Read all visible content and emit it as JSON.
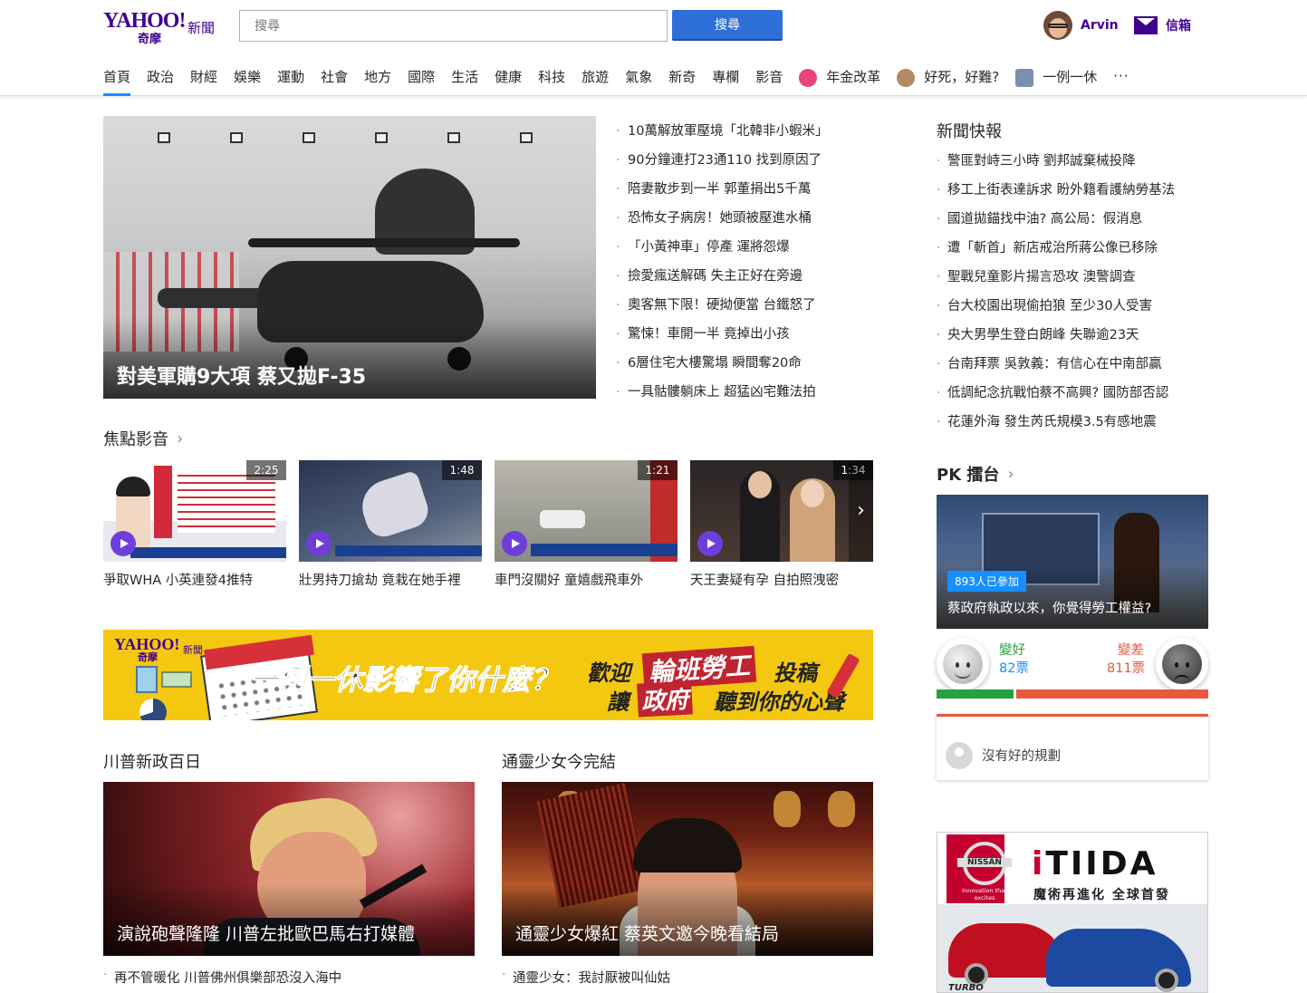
{
  "header": {
    "logo_yahoo": "YAHOO!",
    "logo_sub": "奇摩",
    "logo_section": "新聞",
    "search_placeholder": "搜尋",
    "search_button": "搜尋",
    "user_name": "Arvin",
    "mail_label": "信箱"
  },
  "nav": {
    "items": [
      "首頁",
      "政治",
      "財經",
      "娛樂",
      "運動",
      "社會",
      "地方",
      "國際",
      "生活",
      "健康",
      "科技",
      "旅遊",
      "氣象",
      "新奇",
      "專欄",
      "影音"
    ],
    "special": [
      "年金改革",
      "好死，好難?",
      "一例一休"
    ],
    "more": "···",
    "active": "首頁"
  },
  "hero": {
    "title": "對美軍購9大項 蔡又拋F-35"
  },
  "headlines": [
    "10萬解放軍壓境「北韓非小蝦米」",
    "90分鐘連打23通110 找到原因了",
    "陪妻散步到一半 郭董捐出5千萬",
    "恐怖女子病房！她頭被壓進水桶",
    "「小黃神車」停產 運將怨爆",
    "撿愛瘋送解碼 失主正好在旁邊",
    "奧客無下限！硬拗便當 台鐵怒了",
    "驚悚！車開一半 竟掉出小孩",
    "6層住宅大樓驚塌 瞬間奪20命",
    "一具骷髏躺床上 超猛凶宅難法拍"
  ],
  "videos": {
    "title": "焦點影音",
    "chevron": "›",
    "next": "›",
    "items": [
      {
        "duration": "2:25",
        "caption": "爭取WHA 小英連發4推特"
      },
      {
        "duration": "1:48",
        "caption": "壯男持刀搶劫 竟栽在她手裡"
      },
      {
        "duration": "1:21",
        "caption": "車門沒關好 童嬉戲飛車外"
      },
      {
        "duration": "1:34",
        "caption": "天王妻疑有孕 自拍照洩密"
      }
    ]
  },
  "banner": {
    "yahoo": "YAHOO!",
    "sub": "奇摩",
    "news": "新聞",
    "main": "一例一休影響了你什麼？",
    "welcome": "歡迎",
    "labor": "輪班勞工",
    "submit": "投稿",
    "rang": "讓",
    "gov": "政府",
    "hear": "聽到你的心聲"
  },
  "features": [
    {
      "section": "川普新政百日",
      "title": "演說砲聲隆隆 川普左批歐巴馬右打媒體",
      "sub": "再不管暖化 川普佛州俱樂部恐沒入海中"
    },
    {
      "section": "通靈少女今完結",
      "title": "通靈少女爆紅 蔡英文邀今晚看結局",
      "sub": "通靈少女：我討厭被叫仙姑"
    }
  ],
  "flash": {
    "title": "新聞快報",
    "items": [
      "警匪對峙三小時 劉邦誠棄械投降",
      "移工上街表達訴求 盼外籍看護納勞基法",
      "國道拋錨找中油? 高公局：假消息",
      "遭「斬首」新店戒治所蔣公像已移除",
      "聖戰兒童影片揚言恐攻 澳警調查",
      "台大校園出現偷拍狼 至少30人受害",
      "央大男學生登白朗峰 失聯逾23天",
      "台南拜票 吳敦義：有信心在中南部贏",
      "低調紀念抗戰怕蔡不高興? 國防部否認",
      "花蓮外海 發生芮氏規模3.5有感地震"
    ]
  },
  "pk": {
    "title": "PK 擂台",
    "chevron": "›",
    "participants": "893人已參加",
    "question": "蔡政府執政以來，你覺得勞工權益?",
    "good_label": "變好",
    "good_votes": "82票",
    "bad_label": "變差",
    "bad_votes": "811票",
    "good_count": 82,
    "bad_count": 811,
    "comment": "沒有好的規劃"
  },
  "ad": {
    "brand": "NISSAN",
    "brand_tag": "Innovation that excites",
    "model_i": "i",
    "model_rest": "TIIDA",
    "tagline": "魔術再進化 全球首發",
    "turbo": "TURBO"
  },
  "colors": {
    "brand": "#400090",
    "accent": "#188fff",
    "search": "#2f6fd8",
    "good": "#26a040",
    "bad": "#e8583d"
  }
}
